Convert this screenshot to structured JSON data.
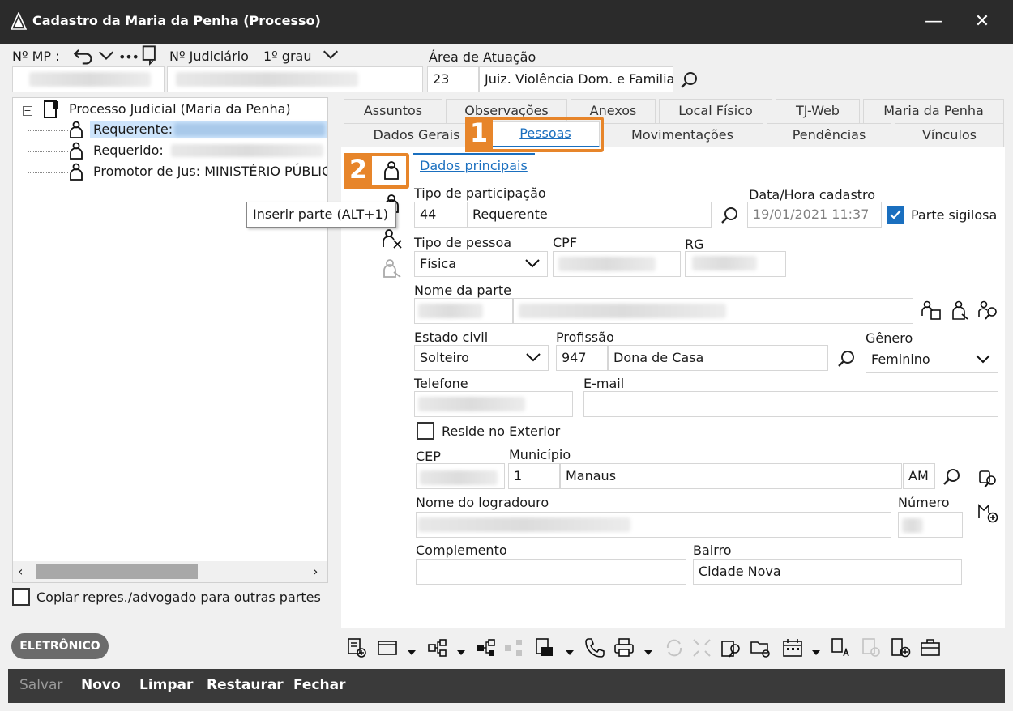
{
  "window": {
    "title": "Cadastro da Maria da Penha (Processo)",
    "minimize": "—",
    "close": "✕"
  },
  "header": {
    "mp_label": "Nº MP :",
    "judicial_label": "Nº Judiciário",
    "grau": "1º grau",
    "area_label": "Área de Atuação",
    "area_code": "23",
    "area_name": "Juiz. Violência Dom. e Familia"
  },
  "tree": {
    "root": "Processo Judicial (Maria da Penha)",
    "items": [
      {
        "label": "Requerente:"
      },
      {
        "label": "Requerido:"
      },
      {
        "label": "Promotor de Jus: MINISTÉRIO PÚBLIC"
      }
    ]
  },
  "copy_option": "Copiar repres./advogado para outras partes",
  "tabs_row1": [
    "Assuntos",
    "Observações",
    "Anexos",
    "Local Físico",
    "TJ-Web",
    "Maria da Penha"
  ],
  "tabs_row2": [
    "Dados Gerais",
    "Pessoas",
    "Movimentações",
    "Pendências",
    "Vínculos"
  ],
  "subtab": "Dados principais",
  "tooltip": "Inserir parte (ALT+1)",
  "callouts": {
    "one": "1",
    "two": "2"
  },
  "form": {
    "tipo_participacao_label": "Tipo de participação",
    "tipo_participacao_code": "44",
    "tipo_participacao_name": "Requerente",
    "data_hora_label": "Data/Hora cadastro",
    "data_hora_value": "19/01/2021 11:37",
    "parte_sigilosa_label": "Parte sigilosa",
    "tipo_pessoa_label": "Tipo de pessoa",
    "tipo_pessoa_value": "Física",
    "cpf_label": "CPF",
    "rg_label": "RG",
    "nome_parte_label": "Nome da parte",
    "estado_civil_label": "Estado civil",
    "estado_civil_value": "Solteiro",
    "profissao_label": "Profissão",
    "profissao_code": "947",
    "profissao_name": "Dona de Casa",
    "genero_label": "Gênero",
    "genero_value": "Feminino",
    "telefone_label": "Telefone",
    "email_label": "E-mail",
    "reside_exterior_label": "Reside no Exterior",
    "cep_label": "CEP",
    "municipio_label": "Município",
    "municipio_code": "1",
    "municipio_name": "Manaus",
    "uf": "AM",
    "logradouro_label": "Nome do logradouro",
    "numero_label": "Número",
    "complemento_label": "Complemento",
    "bairro_label": "Bairro",
    "bairro_value": "Cidade Nova"
  },
  "badge": "ELETRÔNICO",
  "actions": [
    "Salvar",
    "Novo",
    "Limpar",
    "Restaurar",
    "Fechar"
  ],
  "colors": {
    "accent": "#1a6fbf",
    "callout": "#e7852a",
    "titlebar": "#2b2b2b"
  }
}
